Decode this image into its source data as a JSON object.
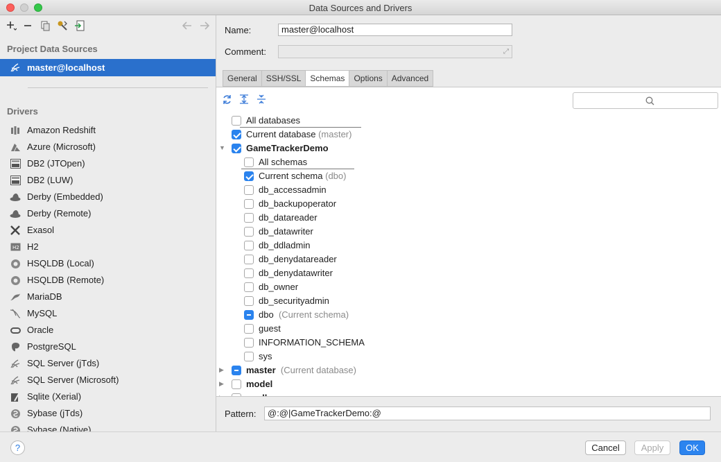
{
  "window": {
    "title": "Data Sources and Drivers"
  },
  "left": {
    "project_header": "Project Data Sources",
    "selected_source": "master@localhost",
    "drivers_header": "Drivers",
    "drivers": [
      {
        "label": "Amazon Redshift",
        "icon": "redshift-icon"
      },
      {
        "label": "Azure (Microsoft)",
        "icon": "azure-icon"
      },
      {
        "label": "DB2 (JTOpen)",
        "icon": "db2-icon"
      },
      {
        "label": "DB2 (LUW)",
        "icon": "db2-icon"
      },
      {
        "label": "Derby (Embedded)",
        "icon": "derby-icon"
      },
      {
        "label": "Derby (Remote)",
        "icon": "derby-icon"
      },
      {
        "label": "Exasol",
        "icon": "exasol-icon"
      },
      {
        "label": "H2",
        "icon": "h2-icon"
      },
      {
        "label": "HSQLDB (Local)",
        "icon": "hsqldb-icon"
      },
      {
        "label": "HSQLDB (Remote)",
        "icon": "hsqldb-icon"
      },
      {
        "label": "MariaDB",
        "icon": "mariadb-icon"
      },
      {
        "label": "MySQL",
        "icon": "mysql-icon"
      },
      {
        "label": "Oracle",
        "icon": "oracle-icon"
      },
      {
        "label": "PostgreSQL",
        "icon": "postgresql-icon"
      },
      {
        "label": "SQL Server (jTds)",
        "icon": "sqlserver-icon"
      },
      {
        "label": "SQL Server (Microsoft)",
        "icon": "sqlserver-icon"
      },
      {
        "label": "Sqlite (Xerial)",
        "icon": "sqlite-icon"
      },
      {
        "label": "Sybase (jTds)",
        "icon": "sybase-icon"
      },
      {
        "label": "Sybase (Native)",
        "icon": "sybase-icon"
      }
    ]
  },
  "form": {
    "name_label": "Name:",
    "name_value": "master@localhost",
    "comment_label": "Comment:",
    "comment_value": ""
  },
  "tabs": [
    {
      "label": "General",
      "active": false
    },
    {
      "label": "SSH/SSL",
      "active": false
    },
    {
      "label": "Schemas",
      "active": true
    },
    {
      "label": "Options",
      "active": false
    },
    {
      "label": "Advanced",
      "active": false
    }
  ],
  "tree": {
    "all_databases": "All databases",
    "current_database": "Current database",
    "current_database_note": "(master)",
    "db1": {
      "name": "GameTrackerDemo",
      "checked": true,
      "expanded": true
    },
    "all_schemas": "All schemas",
    "current_schema": "Current schema",
    "current_schema_note": "(dbo)",
    "schemas": [
      {
        "label": "db_accessadmin",
        "state": "off"
      },
      {
        "label": "db_backupoperator",
        "state": "off"
      },
      {
        "label": "db_datareader",
        "state": "off"
      },
      {
        "label": "db_datawriter",
        "state": "off"
      },
      {
        "label": "db_ddladmin",
        "state": "off"
      },
      {
        "label": "db_denydatareader",
        "state": "off"
      },
      {
        "label": "db_denydatawriter",
        "state": "off"
      },
      {
        "label": "db_owner",
        "state": "off"
      },
      {
        "label": "db_securityadmin",
        "state": "off"
      },
      {
        "label": "dbo",
        "state": "part",
        "note": "(Current schema)"
      },
      {
        "label": "guest",
        "state": "off"
      },
      {
        "label": "INFORMATION_SCHEMA",
        "state": "off"
      },
      {
        "label": "sys",
        "state": "off"
      }
    ],
    "other_dbs": [
      {
        "name": "master",
        "state": "part",
        "note": "(Current database)"
      },
      {
        "name": "model",
        "state": "off"
      },
      {
        "name": "msdb",
        "state": "off"
      }
    ]
  },
  "pattern": {
    "label": "Pattern:",
    "value": "@:@|GameTrackerDemo:@"
  },
  "buttons": {
    "help": "?",
    "cancel": "Cancel",
    "apply": "Apply",
    "ok": "OK"
  },
  "colors": {
    "selection": "#2a70cc",
    "accent": "#2a83ee",
    "ok_button": "#2c84ef"
  }
}
